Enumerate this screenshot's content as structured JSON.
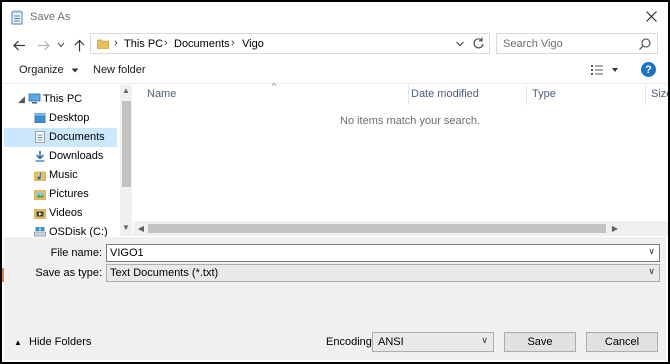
{
  "window": {
    "title": "Save As"
  },
  "address": {
    "segments": [
      "This PC",
      "Documents",
      "Vigo"
    ]
  },
  "search": {
    "placeholder": "Search Vigo"
  },
  "toolbar": {
    "organize_label": "Organize",
    "new_folder_label": "New folder"
  },
  "sidebar": {
    "items": [
      {
        "label": "This PC",
        "icon": "computer-icon",
        "level": 0
      },
      {
        "label": "Desktop",
        "icon": "desktop-folder-icon",
        "level": 1
      },
      {
        "label": "Documents",
        "icon": "documents-folder-icon",
        "level": 1,
        "selected": true
      },
      {
        "label": "Downloads",
        "icon": "downloads-folder-icon",
        "level": 1
      },
      {
        "label": "Music",
        "icon": "music-folder-icon",
        "level": 1
      },
      {
        "label": "Pictures",
        "icon": "pictures-folder-icon",
        "level": 1
      },
      {
        "label": "Videos",
        "icon": "videos-folder-icon",
        "level": 1
      },
      {
        "label": "OSDisk (C:)",
        "icon": "drive-icon",
        "level": 1
      }
    ]
  },
  "file_list": {
    "columns": [
      "Name",
      "Date modified",
      "Type",
      "Size"
    ],
    "empty_message": "No items match your search."
  },
  "form": {
    "file_name_label": "File name:",
    "file_name_value": "VIGO1",
    "save_type_label": "Save as type:",
    "save_type_value": "Text Documents (*.txt)",
    "encoding_label": "Encoding:",
    "encoding_value": "ANSI"
  },
  "footer": {
    "hide_folders_label": "Hide Folders",
    "save_label": "Save",
    "cancel_label": "Cancel"
  },
  "colors": {
    "selected_bg": "#cce8ff",
    "hover_bg": "#e5f3ff",
    "form_bg": "#f0f0f0",
    "help_blue": "#1a73c7",
    "folder_yellow": "#e8c15a"
  }
}
